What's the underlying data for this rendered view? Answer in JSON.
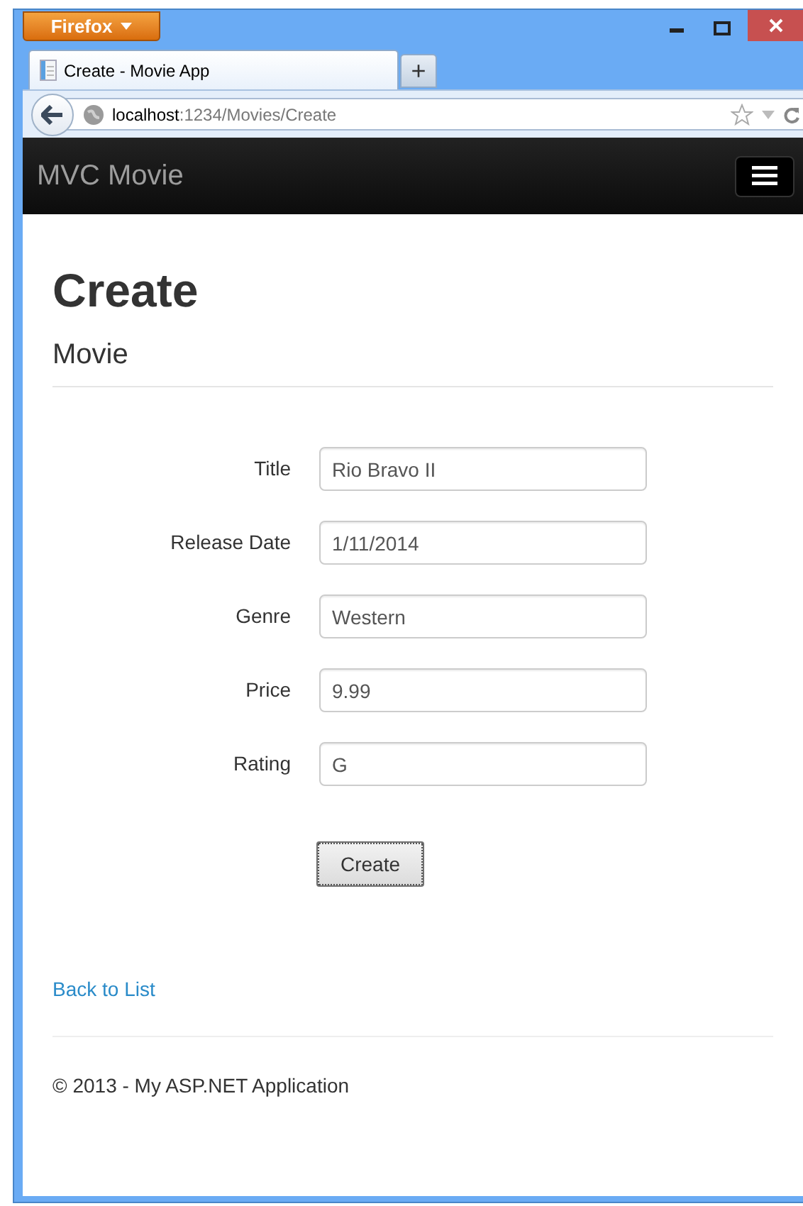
{
  "browser": {
    "menu_button": "Firefox",
    "tabs": [
      {
        "title": "Create - Movie App",
        "selected": true
      }
    ],
    "new_tab": "+",
    "address": {
      "host": "localhost",
      "rest": ":1234/Movies/Create"
    }
  },
  "navbar": {
    "brand": "MVC Movie"
  },
  "page": {
    "heading": "Create",
    "subheading": "Movie",
    "fields": [
      {
        "label": "Title",
        "value": "Rio Bravo II"
      },
      {
        "label": "Release Date",
        "value": "1/11/2014"
      },
      {
        "label": "Genre",
        "value": "Western"
      },
      {
        "label": "Price",
        "value": "9.99"
      },
      {
        "label": "Rating",
        "value": "G"
      }
    ],
    "submit": "Create",
    "back_link": "Back to List",
    "footer": "© 2013 - My ASP.NET Application"
  }
}
